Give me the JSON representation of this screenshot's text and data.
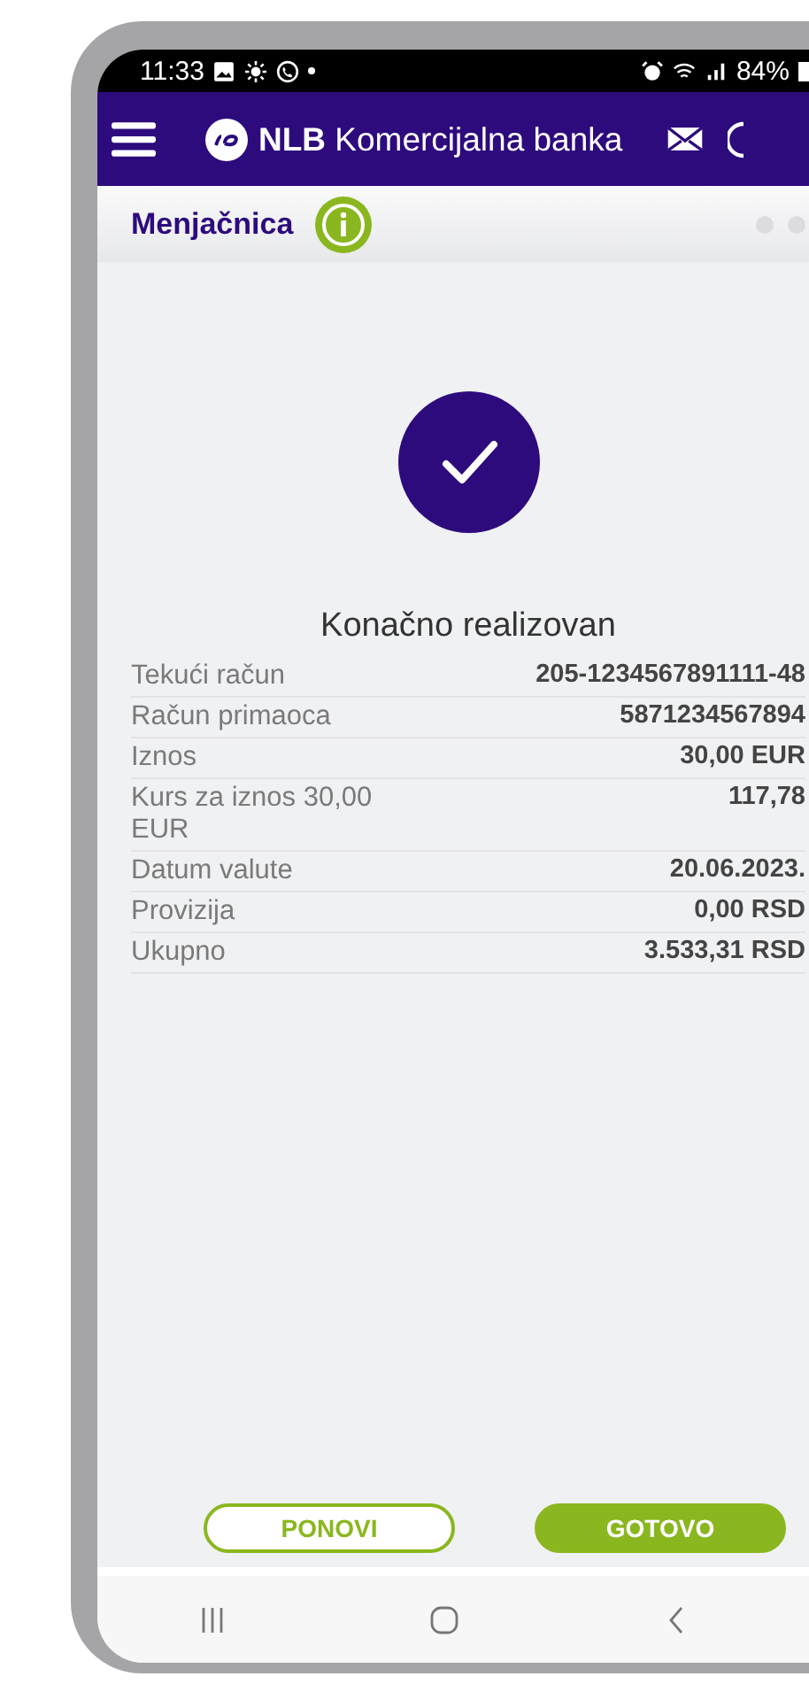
{
  "status_bar": {
    "time": "11:33",
    "battery": "84%"
  },
  "header": {
    "title": "**NLB** Komercijalna banka"
  },
  "subheader": {
    "title": "Menjačnica"
  },
  "result": {
    "title": "Konačno realizovan"
  },
  "details": [
    {
      "label": "Tekući račun",
      "value": "205-1234567891111-48"
    },
    {
      "label": "Račun primaoca",
      "value": "5871234567894"
    },
    {
      "label": "Iznos",
      "value": "30,00 EUR"
    },
    {
      "label": "Kurs za iznos 30,00 EUR",
      "value": "117,78"
    },
    {
      "label": "Datum valute",
      "value": "20.06.2023."
    },
    {
      "label": "Provizija",
      "value": "0,00 RSD"
    },
    {
      "label": "Ukupno",
      "value": "3.533,31 RSD"
    }
  ],
  "buttons": [
    {
      "label": "PONOVI",
      "kind": "outline"
    },
    {
      "label": "GOTOVO",
      "kind": "filled"
    }
  ]
}
